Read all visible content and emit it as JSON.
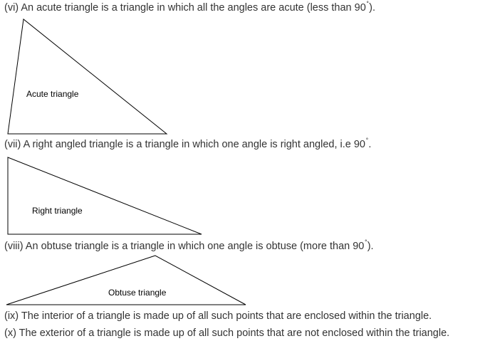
{
  "statements": {
    "vi": {
      "text": "(vi) An acute triangle is a triangle in which all the angles are acute (less than 90",
      "degree": "˚",
      "tail": ")."
    },
    "vii": {
      "text": "(vii) A right angled triangle is a triangle in which one angle is right angled, i.e 90",
      "degree": "˚",
      "tail": "."
    },
    "viii": {
      "text": "(viii) An obtuse triangle is a triangle in which one angle is obtuse (more than 90",
      "degree": "˚",
      "tail": ")."
    },
    "ix": "(ix) The interior of a triangle is made up of all such points that are enclosed within the triangle.",
    "x": "(x) The exterior of a triangle is made up of all such points that are not enclosed within the triangle."
  },
  "figures": {
    "acute_label": "Acute triangle",
    "right_label": "Right triangle",
    "obtuse_label": "Obtuse triangle"
  },
  "colors": {
    "text": "#333333",
    "stroke": "#000000"
  }
}
